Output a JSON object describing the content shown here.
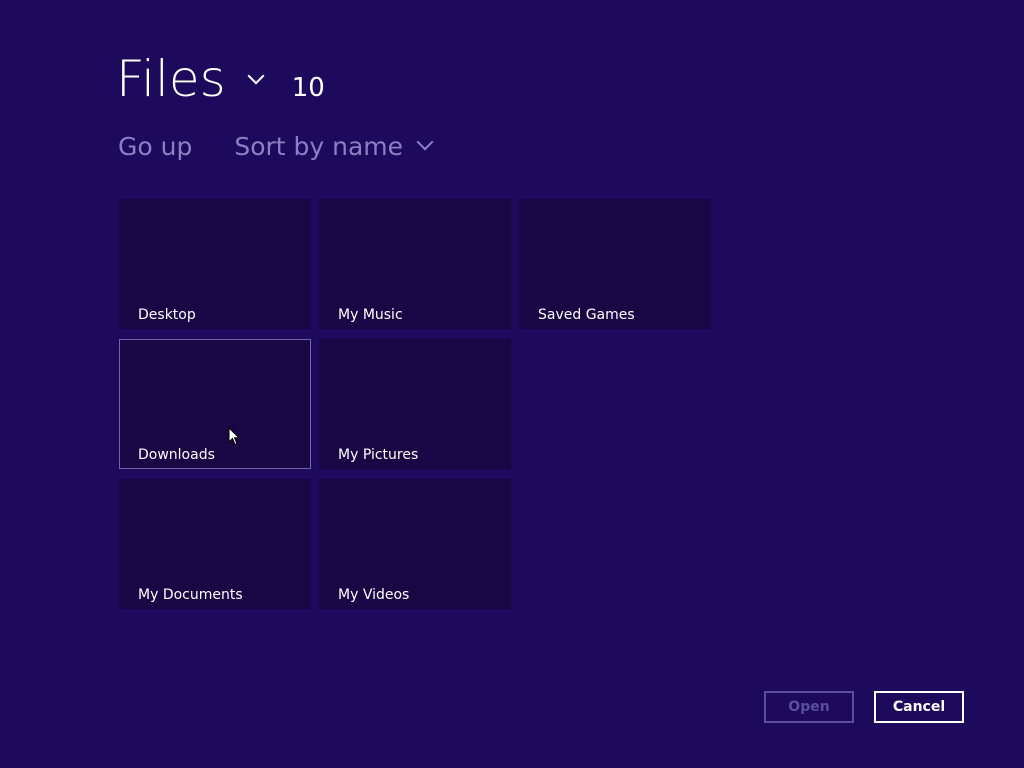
{
  "header": {
    "title": "Files",
    "title_chevron_icon": "chevron-down-icon",
    "item_count": "10"
  },
  "commands": {
    "go_up": "Go up",
    "sort": "Sort by name",
    "sort_chevron_icon": "chevron-down-icon"
  },
  "tiles": [
    {
      "label": "Desktop"
    },
    {
      "label": "My Music"
    },
    {
      "label": "Saved Games"
    },
    {
      "label": "Downloads",
      "selected": true
    },
    {
      "label": "My Pictures"
    },
    {
      "label": "My Documents"
    },
    {
      "label": "My Videos"
    }
  ],
  "buttons": {
    "open": "Open",
    "open_enabled": false,
    "cancel": "Cancel"
  },
  "colors": {
    "background": "#1e0a5c",
    "tile": "#180645",
    "command_text": "#8a80c4",
    "selection_border": "#6f66a8",
    "disabled": "#5a4f9a"
  },
  "cursor_icon": "arrow-pointer-icon"
}
